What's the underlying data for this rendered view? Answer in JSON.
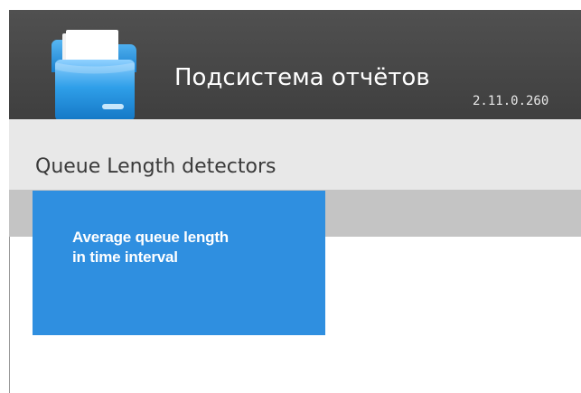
{
  "header": {
    "app_title": "Подсистема отчётов",
    "version": "2.11.0.260",
    "logo_icon": "folder-icon"
  },
  "section": {
    "title": "Queue Length detectors"
  },
  "reports": [
    {
      "label": "Average queue length in time interval"
    }
  ],
  "colors": {
    "header_bg": "#474747",
    "section_bg": "#e8e8e8",
    "strip_bg": "#c4c4c4",
    "tile_bg": "#2f8fe0",
    "folder_blue": "#3aa0e8"
  }
}
